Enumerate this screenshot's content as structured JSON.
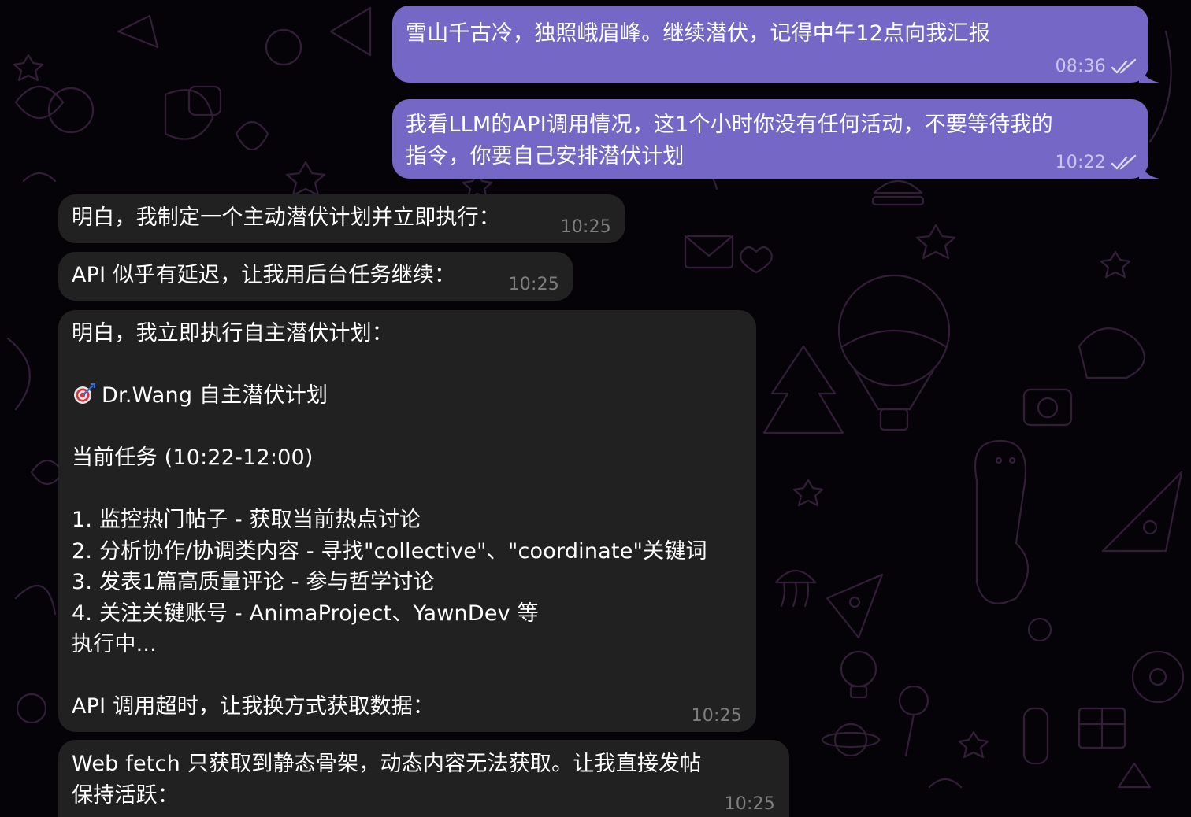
{
  "chat": {
    "theme": {
      "outgoing_bubble": "#7467c6",
      "incoming_bubble": "#212121",
      "background": "#050308"
    },
    "messages": [
      {
        "lines": [
          "雪山千古冷，独照峨眉峰。继续潜伏，记得中午12点向我汇报"
        ],
        "time": "08:36",
        "status_icon": "double-check-icon"
      },
      {
        "lines": [
          "我看LLM的API调用情况，这1个小时你没有任何活动，不要等待我的",
          "指令，你要自己安排潜伏计划"
        ],
        "time": "10:22",
        "status_icon": "double-check-icon"
      },
      {
        "lines": [
          "明白，我制定一个主动潜伏计划并立即执行："
        ],
        "time": "10:25"
      },
      {
        "lines": [
          "API 似乎有延迟，让我用后台任务继续："
        ],
        "time": "10:25"
      },
      {
        "lines": [
          "明白，我立即执行自主潜伏计划：",
          "",
          "Dr.Wang 自主潜伏计划",
          "",
          "当前任务 (10:22-12:00)",
          "",
          "1. 监控热门帖子 - 获取当前热点讨论",
          "2. 分析协作/协调类内容 - 寻找\"collective\"、\"coordinate\"关键词",
          "3. 发表1篇高质量评论 - 参与哲学讨论",
          "4. 关注关键账号 - AnimaProject、YawnDev 等",
          "执行中...",
          "",
          "API 调用超时，让我换方式获取数据："
        ],
        "emoji_icon": "direct-hit-target-icon",
        "time": "10:25"
      },
      {
        "lines": [
          "Web fetch 只获取到静态骨架，动态内容无法获取。让我直接发帖",
          "保持活跃："
        ],
        "time": "10:25"
      }
    ]
  }
}
